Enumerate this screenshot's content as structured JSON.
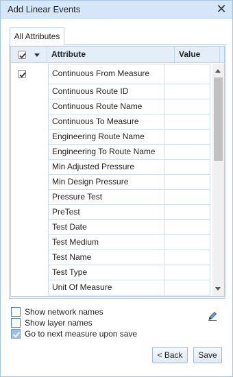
{
  "window": {
    "title": "Add Linear Events",
    "close_icon": "close-icon"
  },
  "tabs": [
    {
      "label": "All Attributes",
      "active": true
    }
  ],
  "grid": {
    "columns": {
      "check": "",
      "attribute": "Attribute",
      "value": "Value"
    },
    "header_checkbox_checked": true,
    "rows": [
      {
        "attribute": "Continuous From Measure",
        "value": "",
        "checked": true
      },
      {
        "attribute": "Continuous Route ID",
        "value": "",
        "checked": false
      },
      {
        "attribute": "Continuous Route Name",
        "value": "",
        "checked": false
      },
      {
        "attribute": "Continuous To Measure",
        "value": "",
        "checked": false
      },
      {
        "attribute": "Engineering Route Name",
        "value": "",
        "checked": false
      },
      {
        "attribute": "Engineering To Route Name",
        "value": "",
        "checked": false
      },
      {
        "attribute": "Min Adjusted Pressure",
        "value": "",
        "checked": false
      },
      {
        "attribute": "Min Design Pressure",
        "value": "",
        "checked": false
      },
      {
        "attribute": "Pressure Test",
        "value": "",
        "checked": false
      },
      {
        "attribute": "PreTest",
        "value": "",
        "checked": false
      },
      {
        "attribute": "Test Date",
        "value": "",
        "checked": false
      },
      {
        "attribute": "Test Medium",
        "value": "",
        "checked": false
      },
      {
        "attribute": "Test Name",
        "value": "",
        "checked": false
      },
      {
        "attribute": "Test Type",
        "value": "",
        "checked": false
      },
      {
        "attribute": "Unit Of Measure",
        "value": "",
        "checked": false
      }
    ]
  },
  "options": [
    {
      "label": "Show network names",
      "checked": false
    },
    {
      "label": "Show layer names",
      "checked": false
    },
    {
      "label": "Go to next measure upon save",
      "checked": true
    }
  ],
  "buttons": {
    "back": "< Back",
    "save": "Save"
  },
  "colors": {
    "titlebar": "#d4e6f7",
    "header": "#e3eef9",
    "border": "#b9cfe3",
    "checkbox_checked": "#9cc0e8"
  }
}
